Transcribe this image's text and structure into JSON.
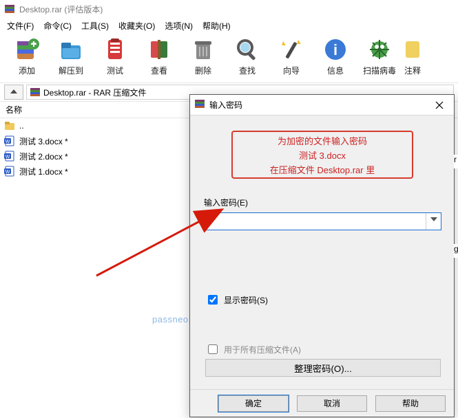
{
  "title": "Desktop.rar (评估版本)",
  "menu": {
    "file": "文件(F)",
    "cmd": "命令(C)",
    "tools": "工具(S)",
    "fav": "收藏夹(O)",
    "opt": "选项(N)",
    "help": "帮助(H)"
  },
  "toolbar": {
    "add": "添加",
    "extract": "解压到",
    "test": "测试",
    "view": "查看",
    "delete": "删除",
    "find": "查找",
    "wizard": "向导",
    "info": "信息",
    "scan": "扫描病毒",
    "comment": "注释"
  },
  "path": "Desktop.rar - RAR 压缩文件",
  "columns": {
    "name": "名称"
  },
  "files": {
    "up": "..",
    "items": [
      {
        "name": "测试 3.docx *"
      },
      {
        "name": "测试 2.docx *"
      },
      {
        "name": "测试 1.docx *"
      }
    ]
  },
  "watermark": "passneo.cn",
  "dialog": {
    "title": "输入密码",
    "msg1": "为加密的文件输入密码",
    "msg2": "测试 3.docx",
    "msg3": "在压缩文件 Desktop.rar 里",
    "label": "输入密码(E)",
    "value": "",
    "chk_show": "显示密码(S)",
    "chk_all": "用于所有压缩文件(A)",
    "organize": "整理密码(O)...",
    "ok": "确定",
    "cancel": "取消",
    "help": "帮助"
  },
  "peek": {
    "r": "r",
    "g": "g"
  }
}
